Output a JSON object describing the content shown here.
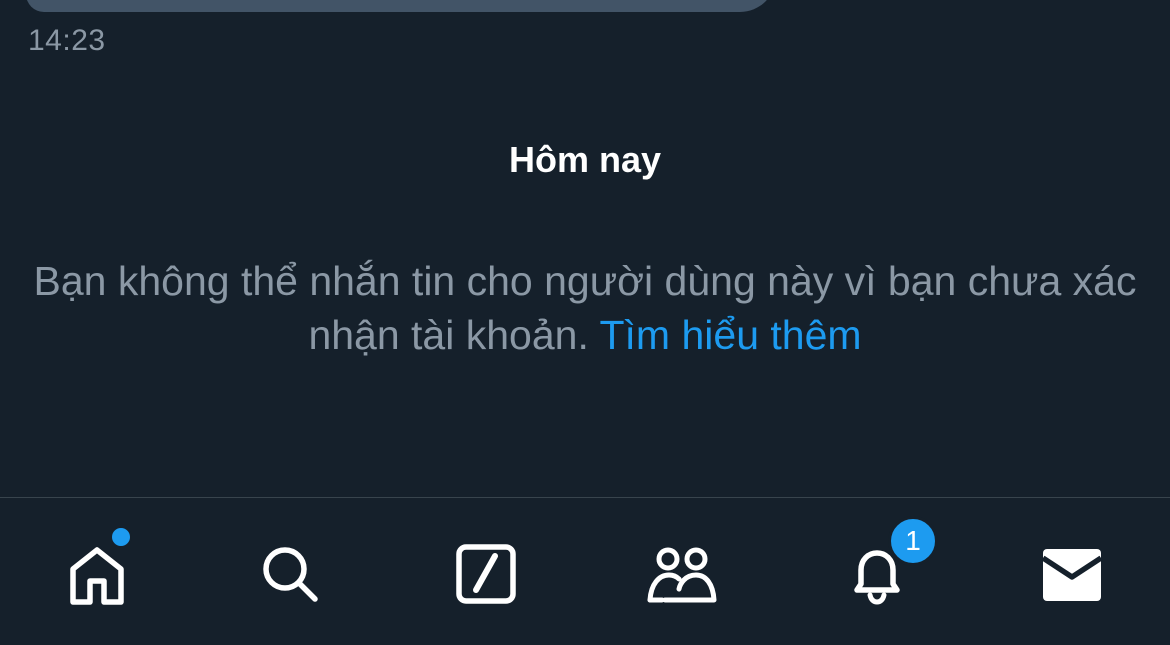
{
  "message": {
    "timestamp": "14:23"
  },
  "divider": {
    "label": "Hôm nay"
  },
  "notice": {
    "text": "Bạn không thể nhắn tin cho người dùng này vì bạn chưa xác nhận tài khoản.",
    "link": "Tìm hiểu thêm"
  },
  "tabbar": {
    "notifications_badge": "1",
    "items": [
      {
        "icon": "home-icon",
        "has_dot": true
      },
      {
        "icon": "search-icon"
      },
      {
        "icon": "grok-icon"
      },
      {
        "icon": "communities-icon"
      },
      {
        "icon": "bell-icon"
      },
      {
        "icon": "mail-icon"
      }
    ]
  },
  "colors": {
    "background": "#15202b",
    "accent": "#1d9bf0",
    "secondary_text": "#8b98a5",
    "bubble": "#425467",
    "divider": "#38444d"
  }
}
